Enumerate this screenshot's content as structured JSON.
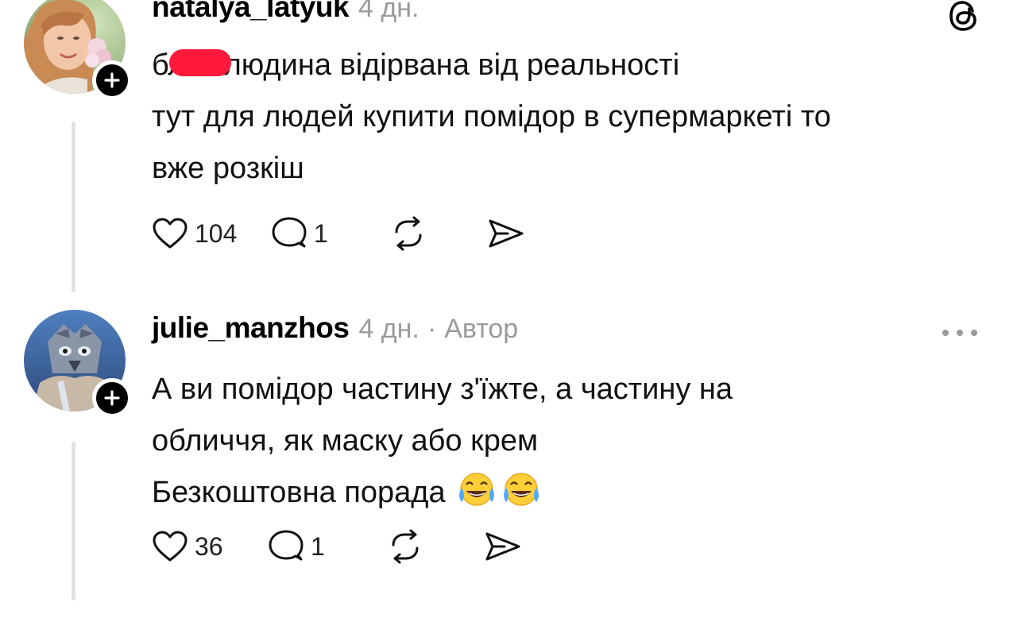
{
  "comments": [
    {
      "username": "natalya_latyuk",
      "time": "4 дн.",
      "lines": [
        {
          "before": "бл",
          "after": "ь людина відірвана від реальності"
        },
        "тут для людей купити помідор в супермаркеті то",
        "вже розкіш"
      ],
      "likes": "104",
      "replies": "1",
      "corner_icon": "threads-logo-icon"
    },
    {
      "username": "julie_manzhos",
      "time": "4 дн.",
      "separator": "·",
      "author_badge": "Автор",
      "lines": [
        "А ви помідор частину з'їжте, а частину на",
        "обличчя, як маску або крем",
        "Безкоштовна порада"
      ],
      "emoji": [
        "tears-of-joy-emoji",
        "tears-of-joy-emoji"
      ],
      "likes": "36",
      "replies": "1",
      "corner_icon": "more-options-icon"
    }
  ],
  "colors": {
    "text": "#111111",
    "muted": "#9a9a9a",
    "thread_line": "#e2e2e2",
    "censor_mark": "#ff1a3c"
  }
}
